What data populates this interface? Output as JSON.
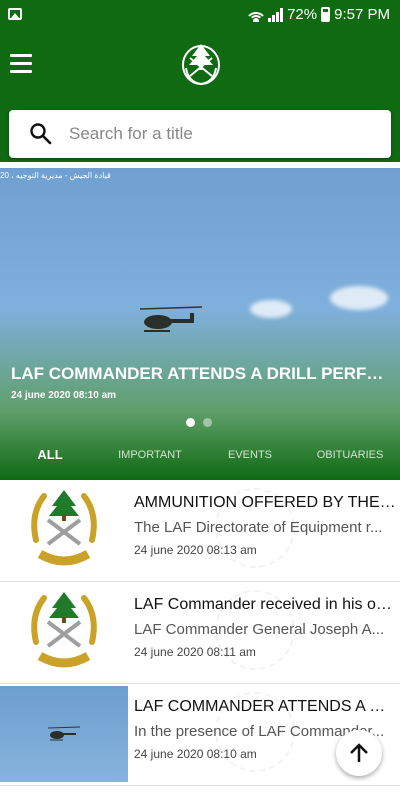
{
  "status_bar": {
    "battery": "72%",
    "time": "9:57 PM"
  },
  "search": {
    "placeholder": "Search for a title"
  },
  "hero": {
    "overlay_text": "قيادة الجيش - مديرية التوجيه ، 20",
    "title": "LAF COMMANDER ATTENDS A DRILL PERFOR...",
    "date": "24 june 2020 08:10 am",
    "slides": 2,
    "active_slide": 1
  },
  "tabs": [
    {
      "label": "ALL",
      "active": true
    },
    {
      "label": "IMPORTANT",
      "active": false
    },
    {
      "label": "EVENTS",
      "active": false
    },
    {
      "label": "OBITUARIES",
      "active": false
    }
  ],
  "articles": [
    {
      "title": "AMMUNITION OFFERED BY THE TU...",
      "desc": "The LAF Directorate of Equipment r...",
      "date": "24 june 2020 08:13 am",
      "thumb": "army-emblem"
    },
    {
      "title": "LAF Commander received in his offi...",
      "desc": "LAF Commander General Joseph A...",
      "date": "24 june 2020 08:11 am",
      "thumb": "army-emblem"
    },
    {
      "title": "LAF COMMANDER ATTENDS A DRI...",
      "desc": "In the presence of LAF Commander...",
      "date": "24 june 2020 08:10 am",
      "thumb": "helicopter-photo"
    }
  ],
  "colors": {
    "primary": "#0f6a12",
    "accent_gold": "#c9a227",
    "cedar_green": "#1f7a2a"
  }
}
